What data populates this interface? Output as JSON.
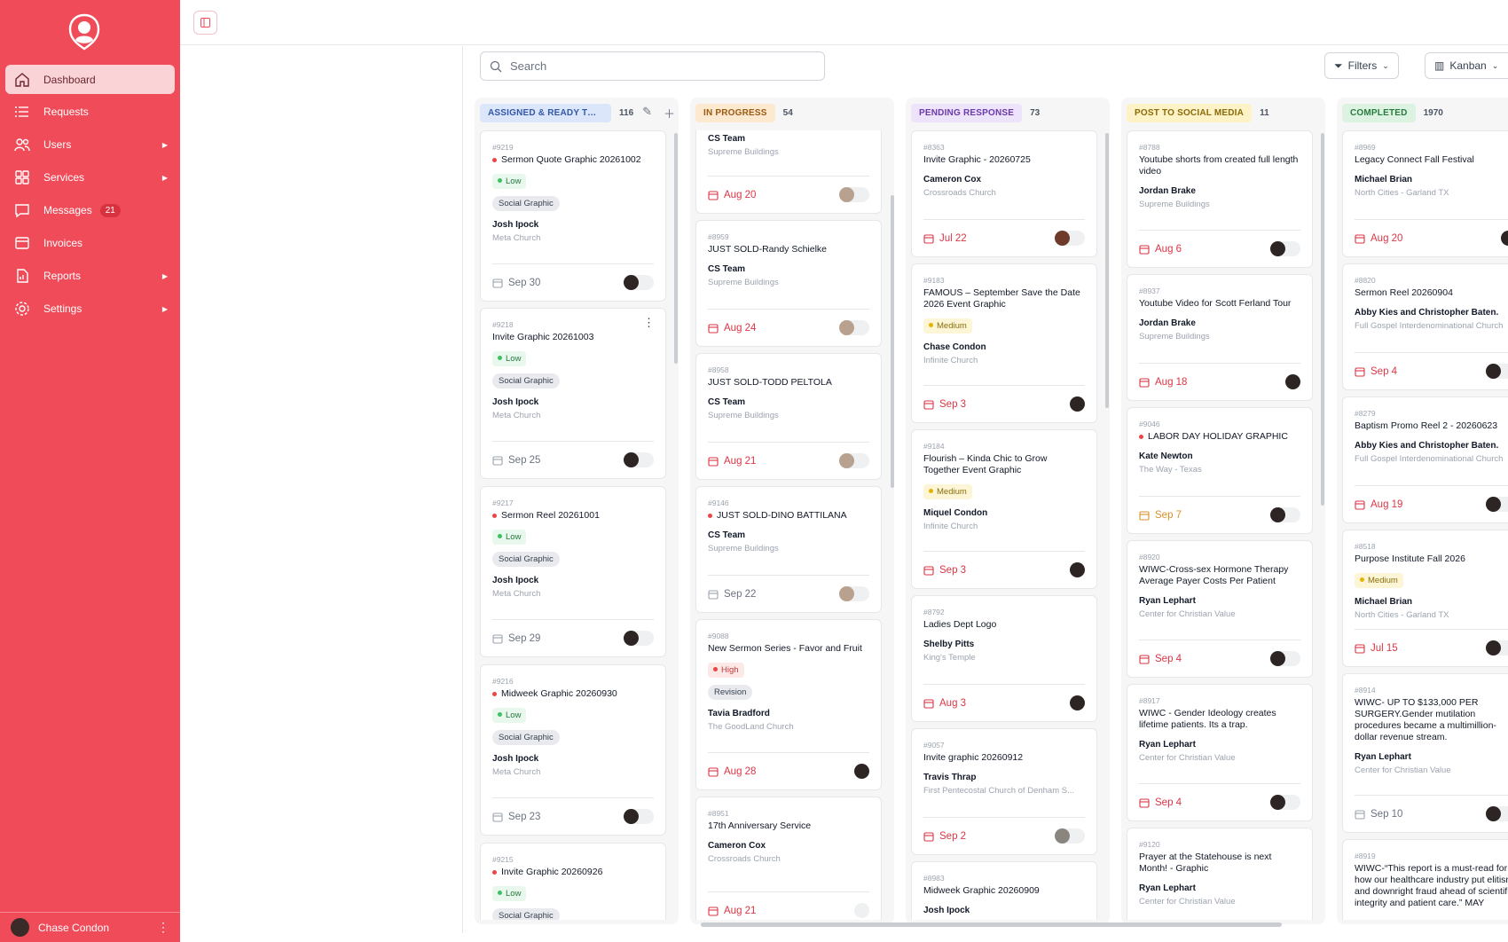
{
  "sidebar": {
    "items": [
      {
        "label": "Dashboard",
        "icon": "home-icon",
        "active": true
      },
      {
        "label": "Requests",
        "icon": "list-icon"
      },
      {
        "label": "Users",
        "icon": "users-icon",
        "caret": true
      },
      {
        "label": "Services",
        "icon": "grid-icon",
        "caret": true
      },
      {
        "label": "Messages",
        "icon": "message-icon",
        "badge": "21"
      },
      {
        "label": "Invoices",
        "icon": "invoice-icon"
      },
      {
        "label": "Reports",
        "icon": "report-icon",
        "caret": true
      },
      {
        "label": "Settings",
        "icon": "settings-icon",
        "caret": true
      }
    ],
    "user": "Chase Condon"
  },
  "toolbar": {
    "search_placeholder": "Search",
    "filters_label": "Filters",
    "view_label": "Kanban"
  },
  "colors": {
    "brand": "#ef4b58",
    "due_red": "#dc3545"
  },
  "columns": [
    {
      "title": "ASSIGNED & READY TO S...",
      "count": "116",
      "pill_bg": "#dce6fb",
      "pill_color": "#3357a8",
      "cards": [
        {
          "id": "#9219",
          "title": "Sermon Quote Graphic 20261002",
          "dot": true,
          "priority": "Low",
          "tag": "Social Graphic",
          "person": "Josh Ipock",
          "org": "Meta Church",
          "due": "Sep 30",
          "due_color": "gray",
          "avatar": "dark",
          "toggle": true
        },
        {
          "id": "#9218",
          "title": "Invite Graphic 20261003",
          "dot": false,
          "priority": "Low",
          "tag": "Social Graphic",
          "person": "Josh Ipock",
          "org": "Meta Church",
          "due": "Sep 25",
          "due_color": "gray",
          "avatar": "dark",
          "toggle": true,
          "menu": true
        },
        {
          "id": "#9217",
          "title": "Sermon Reel 20261001",
          "dot": true,
          "priority": "Low",
          "tag": "Social Graphic",
          "person": "Josh Ipock",
          "org": "Meta Church",
          "due": "Sep 29",
          "due_color": "gray",
          "avatar": "dark",
          "toggle": true
        },
        {
          "id": "#9216",
          "title": "Midweek Graphic 20260930",
          "dot": true,
          "priority": "Low",
          "tag": "Social Graphic",
          "person": "Josh Ipock",
          "org": "Meta Church",
          "due": "Sep 23",
          "due_color": "gray",
          "avatar": "dark",
          "toggle": true
        },
        {
          "id": "#9215",
          "title": "Invite Graphic 20260926",
          "dot": true,
          "priority": "Low",
          "tag": "Social Graphic",
          "person": "",
          "org": "",
          "due": "",
          "due_color": "gray"
        }
      ]
    },
    {
      "title": "IN PROGRESS",
      "count": "54",
      "pill_bg": "#fde9cf",
      "pill_color": "#9a5a12",
      "cards": [
        {
          "id": "",
          "title": "",
          "dot": false,
          "priority": "",
          "tag": "",
          "person": "CS Team",
          "org": "Supreme Buildings",
          "due": "Aug 20",
          "due_color": "red",
          "avatar": "light",
          "toggle": true
        },
        {
          "id": "#8959",
          "title": "JUST SOLD-Randy Schielke",
          "dot": false,
          "priority": "",
          "tag": "",
          "person": "CS Team",
          "org": "Supreme Buildings",
          "due": "Aug 24",
          "due_color": "red",
          "avatar": "light",
          "toggle": true
        },
        {
          "id": "#8958",
          "title": "JUST SOLD-TODD PELTOLA",
          "dot": false,
          "priority": "",
          "tag": "",
          "person": "CS Team",
          "org": "Supreme Buildings",
          "due": "Aug 21",
          "due_color": "red",
          "avatar": "light",
          "toggle": true
        },
        {
          "id": "#9146",
          "title": "JUST SOLD-DINO BATTILANA",
          "dot": true,
          "priority": "",
          "tag": "",
          "person": "CS Team",
          "org": "Supreme Buildings",
          "due": "Sep 22",
          "due_color": "gray",
          "avatar": "light",
          "toggle": true
        },
        {
          "id": "#9088",
          "title": "New Sermon Series - Favor and Fruit",
          "dot": false,
          "priority": "High",
          "tag": "Revision",
          "person": "Tavia Bradford",
          "org": "The GoodLand Church",
          "due": "Aug 28",
          "due_color": "red",
          "avatar": "dark",
          "toggle": false
        },
        {
          "id": "#8951",
          "title": "17th Anniversary Service",
          "dot": false,
          "priority": "",
          "tag": "",
          "person": "Cameron Cox",
          "org": "Crossroads Church",
          "due": "Aug 21",
          "due_color": "red",
          "avatar": "none",
          "toggle": true
        }
      ]
    },
    {
      "title": "PENDING RESPONSE",
      "count": "73",
      "pill_bg": "#ede3fb",
      "pill_color": "#6a3aa8",
      "cards": [
        {
          "id": "#8363",
          "title": "Invite Graphic - 20260725",
          "dot": false,
          "priority": "",
          "tag": "",
          "person": "Cameron Cox",
          "org": "Crossroads Church",
          "due": "Jul 22",
          "due_color": "red",
          "avatar": "brown",
          "toggle": true
        },
        {
          "id": "#9183",
          "title": "FAMOUS – September Save the Date 2026 Event Graphic",
          "dot": false,
          "priority": "Medium",
          "tag": "",
          "person": "Chase Condon",
          "org": "Infinite Church",
          "due": "Sep 3",
          "due_color": "red",
          "avatar": "dark",
          "toggle": false
        },
        {
          "id": "#9184",
          "title": "Flourish – Kinda Chic to Grow Together Event Graphic",
          "dot": false,
          "priority": "Medium",
          "tag": "",
          "person": "Miquel Condon",
          "org": "Infinite Church",
          "due": "Sep 3",
          "due_color": "red",
          "avatar": "dark",
          "toggle": false
        },
        {
          "id": "#8792",
          "title": "Ladies Dept Logo",
          "dot": false,
          "priority": "",
          "tag": "",
          "person": "Shelby Pitts",
          "org": "King's Temple",
          "due": "Aug 3",
          "due_color": "red",
          "avatar": "dark",
          "toggle": false
        },
        {
          "id": "#9057",
          "title": "Invite graphic 20260912",
          "dot": false,
          "priority": "",
          "tag": "",
          "person": "Travis Thrap",
          "org": "First Pentecostal Church of Denham S...",
          "due": "Sep 2",
          "due_color": "red",
          "avatar": "gray",
          "toggle": true
        },
        {
          "id": "#8983",
          "title": "Midweek Graphic 20260909",
          "dot": false,
          "priority": "",
          "tag": "",
          "person": "Josh Ipock",
          "org": "",
          "due": "",
          "due_color": "gray"
        }
      ]
    },
    {
      "title": "POST TO SOCIAL MEDIA",
      "count": "11",
      "pill_bg": "#fdf3c6",
      "pill_color": "#8a6a0a",
      "cards": [
        {
          "id": "#8788",
          "title": "Youtube shorts from created full length video",
          "dot": false,
          "priority": "",
          "tag": "",
          "person": "Jordan Brake",
          "org": "Supreme Buildings",
          "due": "Aug 6",
          "due_color": "red",
          "avatar": "dark",
          "toggle": true
        },
        {
          "id": "#8937",
          "title": "Youtube Video for Scott Ferland Tour",
          "dot": false,
          "priority": "",
          "tag": "",
          "person": "Jordan Brake",
          "org": "Supreme Buildings",
          "due": "Aug 18",
          "due_color": "red",
          "avatar": "dark",
          "toggle": false
        },
        {
          "id": "#9046",
          "title": "LABOR DAY HOLIDAY GRAPHIC",
          "dot": true,
          "priority": "",
          "tag": "",
          "person": "Kate Newton",
          "org": "The Way - Texas",
          "due": "Sep 7",
          "due_color": "amber",
          "avatar": "dark",
          "toggle": true
        },
        {
          "id": "#8920",
          "title": "WIWC-Cross-sex Hormone Therapy Average Payer Costs Per Patient",
          "dot": false,
          "priority": "",
          "tag": "",
          "person": "Ryan Lephart",
          "org": "Center for Christian Value",
          "due": "Sep 4",
          "due_color": "red",
          "avatar": "dark",
          "toggle": true
        },
        {
          "id": "#8917",
          "title": "WIWC - Gender Ideology creates lifetime patients. Its a trap.",
          "dot": false,
          "priority": "",
          "tag": "",
          "person": "Ryan Lephart",
          "org": "Center for Christian Value",
          "due": "Sep 4",
          "due_color": "red",
          "avatar": "dark",
          "toggle": true
        },
        {
          "id": "#9120",
          "title": "Prayer at the Statehouse is next Month! - Graphic",
          "dot": false,
          "priority": "",
          "tag": "",
          "person": "Ryan Lephart",
          "org": "Center for Christian Value",
          "due": "",
          "due_color": "gray"
        }
      ]
    },
    {
      "title": "COMPLETED",
      "count": "1970",
      "pill_bg": "#dcf3e1",
      "pill_color": "#2a7a3f",
      "cards": [
        {
          "id": "#8969",
          "title": "Legacy Connect Fall Festival",
          "dot": false,
          "priority": "",
          "tag": "",
          "person": "Michael Brian",
          "org": "North Cities - Garland TX",
          "due": "Aug 20",
          "due_color": "red",
          "avatar": "dark",
          "toggle": false
        },
        {
          "id": "#8820",
          "title": "Sermon Reel 20260904",
          "dot": false,
          "priority": "",
          "tag": "",
          "person": "Abby Kies and Christopher Baten.",
          "org": "Full Gospel Interdenominational Church",
          "due": "Sep 4",
          "due_color": "red",
          "avatar": "dark",
          "toggle": true
        },
        {
          "id": "#8279",
          "title": "Baptism Promo Reel 2 - 20260623",
          "dot": false,
          "priority": "",
          "tag": "",
          "person": "Abby Kies and Christopher Baten.",
          "org": "Full Gospel Interdenominational Church",
          "due": "Aug 19",
          "due_color": "red",
          "avatar": "dark",
          "toggle": true
        },
        {
          "id": "#8518",
          "title": "Purpose Institute Fall 2026",
          "dot": false,
          "priority": "Medium",
          "tag": "",
          "person": "Michael Brian",
          "org": "North Cities - Garland TX",
          "due": "Jul 15",
          "due_color": "red",
          "avatar": "dark",
          "toggle": true
        },
        {
          "id": "#8914",
          "title": "WIWC- UP TO $133,000 PER SURGERY.Gender mutilation procedures became a multimillion-dollar revenue stream.",
          "dot": false,
          "priority": "",
          "tag": "",
          "person": "Ryan Lephart",
          "org": "Center for Christian Value",
          "due": "Sep 10",
          "due_color": "gray",
          "avatar": "dark",
          "toggle": true
        },
        {
          "id": "#8919",
          "title": "WIWC-“This report is a must-read for how our healthcare industry put elitism and downright fraud ahead of scientific integrity and patient care.” MAY",
          "dot": false,
          "priority": "",
          "tag": "",
          "person": "",
          "org": "",
          "due": "",
          "due_color": "gray"
        }
      ]
    }
  ]
}
